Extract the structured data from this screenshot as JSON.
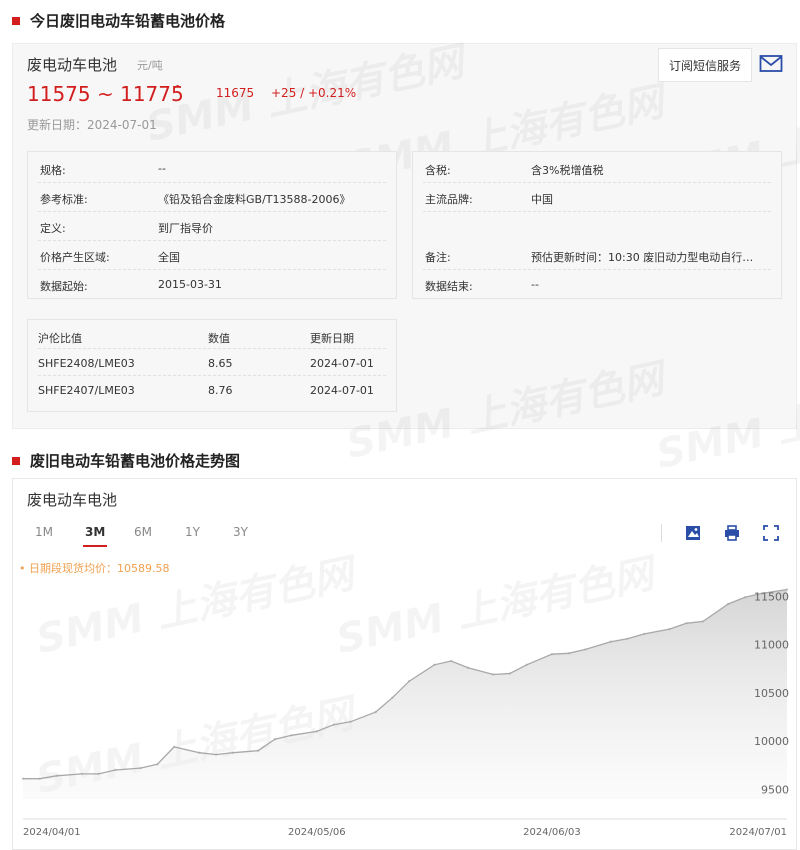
{
  "section1_title": "今日废旧电动车铅蓄电池价格",
  "price": {
    "name": "废电动车电池",
    "unit": "元/吨",
    "range": "11575 ~ 11775",
    "avg": "11675",
    "change": "+25 / +0.21%",
    "update_date": "更新日期：2024-07-01",
    "subscribe_label": "订阅短信服务"
  },
  "specs_left": [
    {
      "k": "规格:",
      "v": "--"
    },
    {
      "k": "参考标准:",
      "v": "《铅及铅合金废料GB/T13588-2006》"
    },
    {
      "k": "定义:",
      "v": "到厂指导价"
    },
    {
      "k": "价格产生区域:",
      "v": "全国"
    },
    {
      "k": "数据起始:",
      "v": "2015-03-31"
    }
  ],
  "specs_right": [
    {
      "k": "含税:",
      "v": "含3%税增值税"
    },
    {
      "k": "主流品牌:",
      "v": "中国"
    },
    {
      "k": "备注:",
      "v": "预估更新时间：10:30 废旧动力型电动自行…"
    },
    {
      "k": "数据结束:",
      "v": "--"
    }
  ],
  "ratio_table": {
    "headers": [
      "沪伦比值",
      "数值",
      "更新日期"
    ],
    "rows": [
      [
        "SHFE2408/LME03",
        "8.65",
        "2024-07-01"
      ],
      [
        "SHFE2407/LME03",
        "8.76",
        "2024-07-01"
      ]
    ]
  },
  "section2_title": "废旧电动车铅蓄电池价格走势图",
  "chart_panel": {
    "name": "废电动车电池",
    "tabs": [
      "1M",
      "3M",
      "6M",
      "1Y",
      "3Y"
    ],
    "active_tab": "3M",
    "legend": "• 日期段现货均价：10589.58"
  },
  "watermark_text": "SMM 上海有色网",
  "colors": {
    "accent_red": "#d21e1e",
    "legend_orange": "#f0a050",
    "line_gray": "#a8a8a8"
  },
  "chart_data": {
    "type": "area",
    "x_tick_labels": [
      "2024/04/01",
      "2024/05/06",
      "2024/06/03",
      "2024/07/01"
    ],
    "x_ticks": [
      "2024-04-01",
      "2024-05-06",
      "2024-06-03",
      "2024-07-01"
    ],
    "y_ticks": [
      9500,
      10000,
      10500,
      11000,
      11500
    ],
    "ylim": [
      9400,
      11700
    ],
    "xlim": [
      "2024-04-01",
      "2024-07-01"
    ],
    "grid": false,
    "series": [
      {
        "x": [
          "2024-04-01",
          "2024-04-03",
          "2024-04-05",
          "2024-04-08",
          "2024-04-10",
          "2024-04-12",
          "2024-04-15",
          "2024-04-17",
          "2024-04-19",
          "2024-04-22",
          "2024-04-24",
          "2024-04-26",
          "2024-04-29",
          "2024-05-01",
          "2024-05-03",
          "2024-05-06",
          "2024-05-08",
          "2024-05-10",
          "2024-05-13",
          "2024-05-15",
          "2024-05-17",
          "2024-05-20",
          "2024-05-22",
          "2024-05-24",
          "2024-05-27",
          "2024-05-29",
          "2024-05-31",
          "2024-06-03",
          "2024-06-05",
          "2024-06-07",
          "2024-06-10",
          "2024-06-12",
          "2024-06-14",
          "2024-06-17",
          "2024-06-19",
          "2024-06-21",
          "2024-06-24",
          "2024-06-26",
          "2024-06-28",
          "2024-07-01"
        ],
        "values": [
          9610,
          9610,
          9640,
          9660,
          9660,
          9700,
          9720,
          9760,
          9940,
          9880,
          9860,
          9880,
          9900,
          10020,
          10060,
          10100,
          10170,
          10200,
          10300,
          10450,
          10620,
          10790,
          10830,
          10760,
          10690,
          10700,
          10790,
          10900,
          10910,
          10950,
          11030,
          11060,
          11110,
          11160,
          11220,
          11240,
          11420,
          11490,
          11530,
          11570
        ]
      }
    ]
  }
}
